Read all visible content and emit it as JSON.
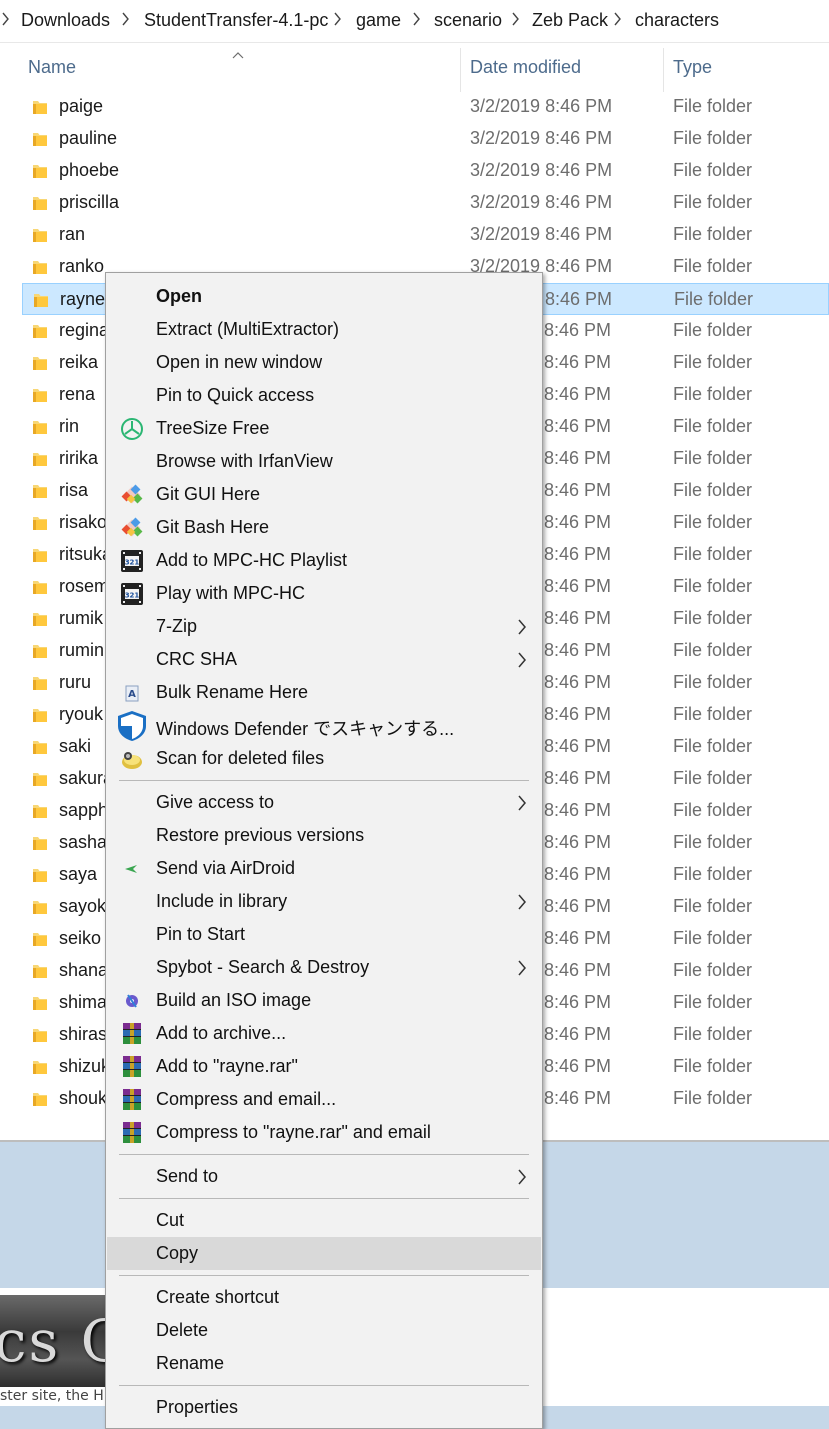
{
  "breadcrumb": [
    "Downloads",
    "StudentTransfer-4.1-pc",
    "game",
    "scenario",
    "Zeb Pack",
    "characters"
  ],
  "columns": {
    "name": "Name",
    "date": "Date modified",
    "type": "Type"
  },
  "files": [
    {
      "name": "paige",
      "date": "3/2/2019 8:46 PM",
      "type": "File folder"
    },
    {
      "name": "pauline",
      "date": "3/2/2019 8:46 PM",
      "type": "File folder"
    },
    {
      "name": "phoebe",
      "date": "3/2/2019 8:46 PM",
      "type": "File folder"
    },
    {
      "name": "priscilla",
      "date": "3/2/2019 8:46 PM",
      "type": "File folder"
    },
    {
      "name": "ran",
      "date": "3/2/2019 8:46 PM",
      "type": "File folder"
    },
    {
      "name": "ranko",
      "date": "3/2/2019 8:46 PM",
      "type": "File folder"
    },
    {
      "name": "rayne",
      "date": "8:46 PM",
      "type": "File folder"
    },
    {
      "name": "regina",
      "date": "8:46 PM",
      "type": "File folder"
    },
    {
      "name": "reika",
      "date": "8:46 PM",
      "type": "File folder"
    },
    {
      "name": "rena",
      "date": "8:46 PM",
      "type": "File folder"
    },
    {
      "name": "rin",
      "date": "8:46 PM",
      "type": "File folder"
    },
    {
      "name": "ririka",
      "date": "8:46 PM",
      "type": "File folder"
    },
    {
      "name": "risa",
      "date": "8:46 PM",
      "type": "File folder"
    },
    {
      "name": "risako",
      "date": "8:46 PM",
      "type": "File folder"
    },
    {
      "name": "ritsuka",
      "date": "8:46 PM",
      "type": "File folder"
    },
    {
      "name": "rosem",
      "date": "8:46 PM",
      "type": "File folder"
    },
    {
      "name": "rumik",
      "date": "8:46 PM",
      "type": "File folder"
    },
    {
      "name": "rumin",
      "date": "8:46 PM",
      "type": "File folder"
    },
    {
      "name": "ruru",
      "date": "8:46 PM",
      "type": "File folder"
    },
    {
      "name": "ryouk",
      "date": "8:46 PM",
      "type": "File folder"
    },
    {
      "name": "saki",
      "date": "8:46 PM",
      "type": "File folder"
    },
    {
      "name": "sakura",
      "date": "8:46 PM",
      "type": "File folder"
    },
    {
      "name": "sapph",
      "date": "8:46 PM",
      "type": "File folder"
    },
    {
      "name": "sasha",
      "date": "8:46 PM",
      "type": "File folder"
    },
    {
      "name": "saya",
      "date": "8:46 PM",
      "type": "File folder"
    },
    {
      "name": "sayok",
      "date": "8:46 PM",
      "type": "File folder"
    },
    {
      "name": "seiko",
      "date": "8:46 PM",
      "type": "File folder"
    },
    {
      "name": "shana",
      "date": "8:46 PM",
      "type": "File folder"
    },
    {
      "name": "shima",
      "date": "8:46 PM",
      "type": "File folder"
    },
    {
      "name": "shiras",
      "date": "8:46 PM",
      "type": "File folder"
    },
    {
      "name": "shizuk",
      "date": "8:46 PM",
      "type": "File folder"
    },
    {
      "name": "shouk",
      "date": "8:46 PM",
      "type": "File folder"
    }
  ],
  "selected_file": "rayne",
  "context_menu": [
    {
      "label": "Open",
      "bold": true,
      "icon": "",
      "submenu": false
    },
    {
      "label": "Extract (MultiExtractor)",
      "icon": "",
      "submenu": false
    },
    {
      "label": "Open in new window",
      "icon": "",
      "submenu": false
    },
    {
      "label": "Pin to Quick access",
      "icon": "",
      "submenu": false
    },
    {
      "label": "TreeSize Free",
      "icon": "treesize-icon",
      "submenu": false
    },
    {
      "label": "Browse with IrfanView",
      "icon": "",
      "submenu": false
    },
    {
      "label": "Git GUI Here",
      "icon": "git-icon",
      "submenu": false
    },
    {
      "label": "Git Bash Here",
      "icon": "git-icon",
      "submenu": false
    },
    {
      "label": "Add to MPC-HC Playlist",
      "icon": "mpc-hc-icon",
      "submenu": false
    },
    {
      "label": "Play with MPC-HC",
      "icon": "mpc-hc-icon",
      "submenu": false
    },
    {
      "label": "7-Zip",
      "icon": "",
      "submenu": true
    },
    {
      "label": "CRC SHA",
      "icon": "",
      "submenu": true
    },
    {
      "label": "Bulk Rename Here",
      "icon": "bulk-rename-icon",
      "submenu": false
    },
    {
      "label": "Windows Defender でスキャンする...",
      "icon": "defender-shield-icon",
      "submenu": false
    },
    {
      "label": "Scan for deleted files",
      "icon": "recuva-icon",
      "submenu": false
    },
    {
      "separator": true
    },
    {
      "label": "Give access to",
      "icon": "",
      "submenu": true
    },
    {
      "label": "Restore previous versions",
      "icon": "",
      "submenu": false
    },
    {
      "label": "Send via AirDroid",
      "icon": "airdroid-icon",
      "submenu": false
    },
    {
      "label": "Include in library",
      "icon": "",
      "submenu": true
    },
    {
      "label": "Pin to Start",
      "icon": "",
      "submenu": false
    },
    {
      "label": "Spybot - Search & Destroy",
      "icon": "",
      "submenu": true
    },
    {
      "label": "Build an ISO image",
      "icon": "iso-icon",
      "submenu": false
    },
    {
      "label": "Add to archive...",
      "icon": "winrar-icon",
      "submenu": false
    },
    {
      "label": "Add to \"rayne.rar\"",
      "icon": "winrar-icon",
      "submenu": false
    },
    {
      "label": "Compress and email...",
      "icon": "winrar-icon",
      "submenu": false
    },
    {
      "label": "Compress to \"rayne.rar\" and email",
      "icon": "winrar-icon",
      "submenu": false
    },
    {
      "separator": true
    },
    {
      "label": "Send to",
      "icon": "",
      "submenu": true
    },
    {
      "separator": true
    },
    {
      "label": "Cut",
      "icon": "",
      "submenu": false
    },
    {
      "label": "Copy",
      "icon": "",
      "submenu": false,
      "hover": true
    },
    {
      "separator": true
    },
    {
      "label": "Create shortcut",
      "icon": "",
      "submenu": false
    },
    {
      "label": "Delete",
      "icon": "",
      "submenu": false
    },
    {
      "label": "Rename",
      "icon": "",
      "submenu": false
    },
    {
      "separator": true
    },
    {
      "label": "Properties",
      "icon": "",
      "submenu": false
    }
  ],
  "background_page": {
    "banner_text": "cs C",
    "footer_text": "ster site, the H"
  },
  "colors": {
    "selection": "#cce8ff",
    "menu_bg": "#f2f2f2",
    "menu_hover": "#d9d9d9",
    "header_text": "#4d6b8c",
    "page_blue": "#c5d7e8"
  }
}
